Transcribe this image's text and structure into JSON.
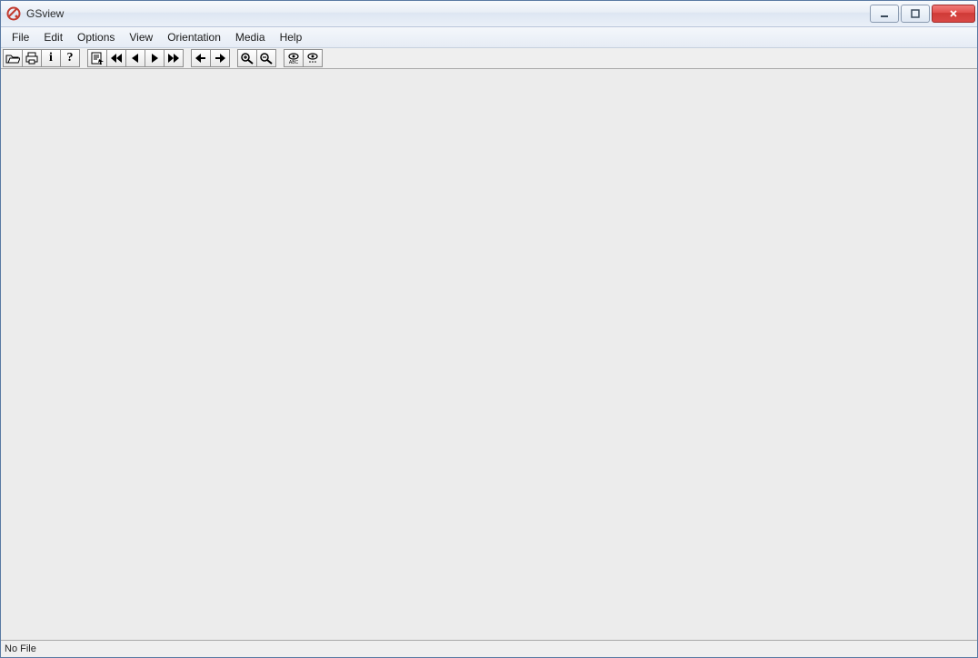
{
  "app": {
    "title": "GSview"
  },
  "menu": {
    "file": "File",
    "edit": "Edit",
    "options": "Options",
    "view": "View",
    "orientation": "Orientation",
    "media": "Media",
    "help": "Help"
  },
  "toolbar": {
    "open": {
      "name": "open-icon"
    },
    "print": {
      "name": "print-icon"
    },
    "info": {
      "name": "info-icon",
      "glyph": "i"
    },
    "help": {
      "name": "help-icon",
      "glyph": "?"
    },
    "select_text": {
      "name": "select-text-icon"
    },
    "first_page": {
      "name": "first-page-icon"
    },
    "prev_page": {
      "name": "prev-page-icon"
    },
    "next_page": {
      "name": "next-page-icon"
    },
    "last_page": {
      "name": "last-page-icon"
    },
    "back": {
      "name": "back-icon"
    },
    "forward": {
      "name": "forward-icon"
    },
    "zoom_in": {
      "name": "zoom-in-icon"
    },
    "zoom_out": {
      "name": "zoom-out-icon"
    },
    "find_text": {
      "name": "find-text-icon"
    },
    "find_next": {
      "name": "find-next-icon"
    }
  },
  "status": {
    "text": "No File"
  }
}
